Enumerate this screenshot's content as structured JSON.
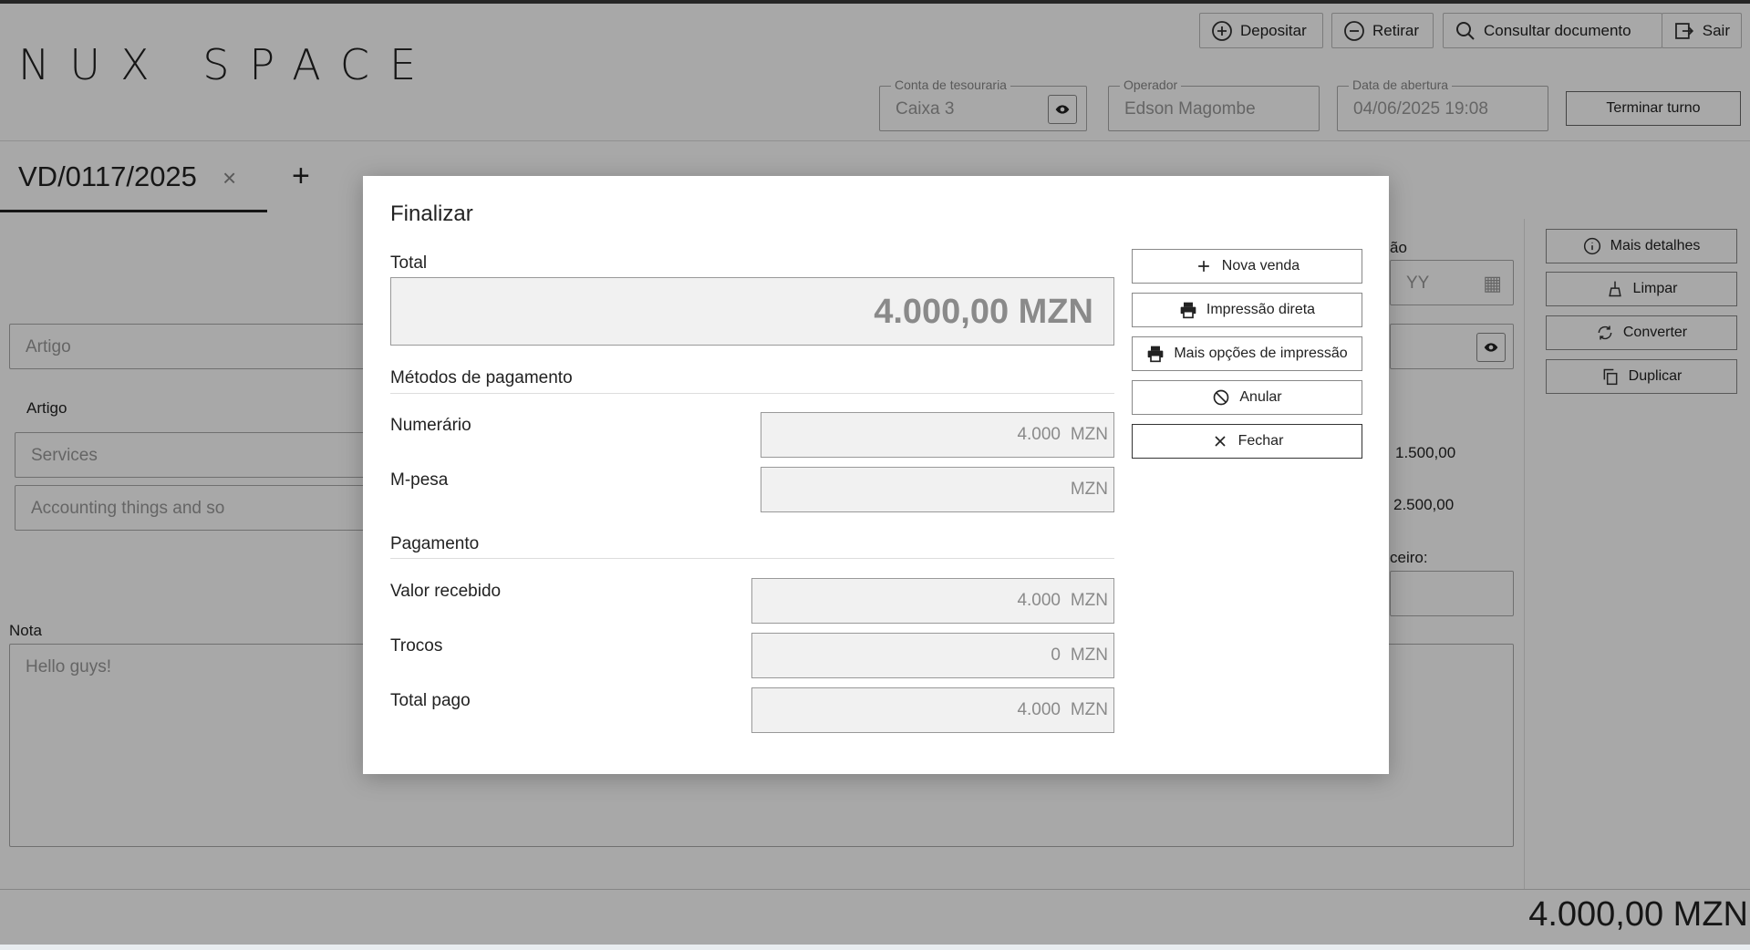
{
  "app": {
    "logo": "NUX SPACE"
  },
  "header_actions": [
    {
      "label": "Depositar",
      "icon": "plus-circle-icon"
    },
    {
      "label": "Retirar",
      "icon": "minus-circle-icon"
    },
    {
      "label": "Consultar documento",
      "icon": "search-icon"
    },
    {
      "label": "Sair",
      "icon": "logout-icon"
    }
  ],
  "session": {
    "treasury_label": "Conta de tesouraria",
    "treasury_value": "Caixa 3",
    "operator_label": "Operador",
    "operator_value": "Edson Magombe",
    "opening_label": "Data de abertura",
    "opening_value": "04/06/2025 19:08",
    "end_shift": "Terminar turno"
  },
  "tabs": [
    {
      "label": "VD/0117/2025"
    }
  ],
  "background": {
    "article_placeholder": "Artigo",
    "article_column": "Artigo",
    "rows": [
      {
        "article": "Services",
        "amount": "1.500,00"
      },
      {
        "article": "Accounting things and so",
        "amount": "2.500,00"
      }
    ],
    "date_label_partial": "ão",
    "date_placeholder_partial": "YY",
    "third_party_label_partial": "ceiro:",
    "note_label": "Nota",
    "note_value": "Hello guys!",
    "total": "4.000,00 MZN"
  },
  "side_actions": [
    {
      "label": "Mais detalhes",
      "icon": "info-icon"
    },
    {
      "label": "Limpar",
      "icon": "broom-icon"
    },
    {
      "label": "Converter",
      "icon": "refresh-icon"
    },
    {
      "label": "Duplicar",
      "icon": "copy-icon"
    }
  ],
  "modal": {
    "title": "Finalizar",
    "total_label": "Total",
    "total_value": "4.000,00 MZN",
    "methods_title": "Métodos de pagamento",
    "methods": [
      {
        "label": "Numerário",
        "value": "4.000",
        "unit": "MZN"
      },
      {
        "label": "M-pesa",
        "value": "",
        "unit": "MZN"
      }
    ],
    "payment_title": "Pagamento",
    "payment": [
      {
        "label": "Valor recebido",
        "value": "4.000",
        "unit": "MZN"
      },
      {
        "label": "Trocos",
        "value": "0",
        "unit": "MZN"
      },
      {
        "label": "Total pago",
        "value": "4.000",
        "unit": "MZN"
      }
    ],
    "buttons": [
      {
        "label": "Nova venda",
        "icon": "plus-icon"
      },
      {
        "label": "Impressão direta",
        "icon": "printer-icon"
      },
      {
        "label": "Mais opções de impressão",
        "icon": "printer-icon"
      },
      {
        "label": "Anular",
        "icon": "block-icon"
      },
      {
        "label": "Fechar",
        "icon": "close-icon"
      }
    ]
  }
}
